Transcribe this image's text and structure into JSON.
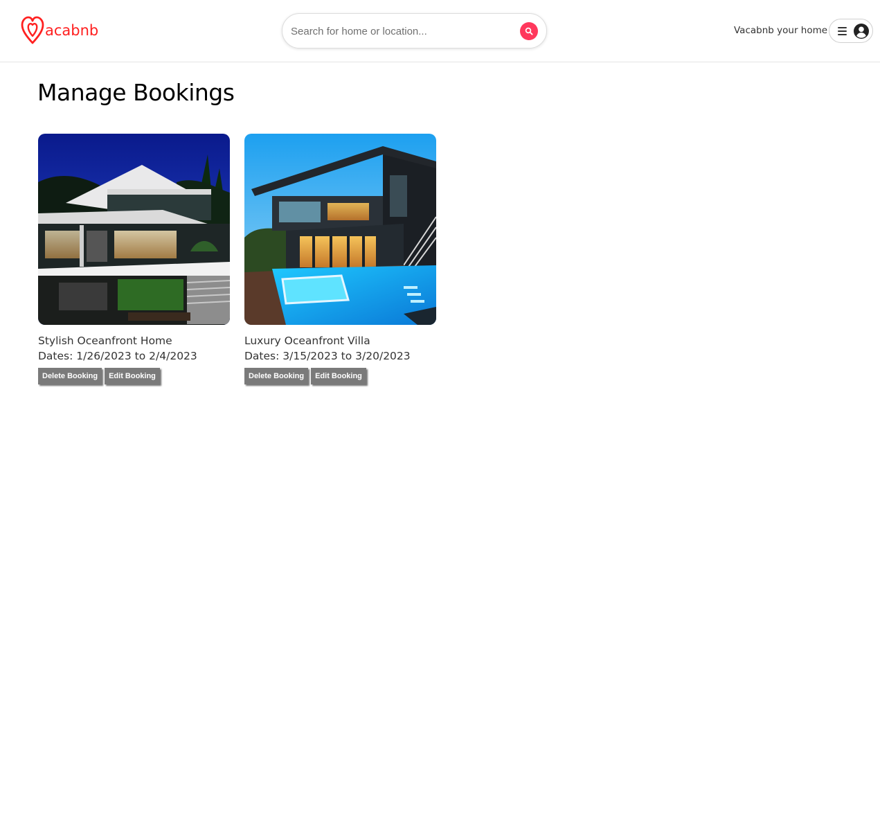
{
  "header": {
    "logo_text": "acabnb",
    "brand_color": "#ff2020",
    "search": {
      "placeholder": "Search for home or location...",
      "value": ""
    },
    "host_link": "Vacabnb your home",
    "icons": {
      "search": "search-icon",
      "menu": "hamburger-menu-icon",
      "avatar": "user-avatar-icon"
    }
  },
  "main": {
    "title": "Manage Bookings",
    "bookings": [
      {
        "name": "Stylish Oceanfront Home",
        "dates": "Dates: 1/26/2023 to 2/4/2023",
        "delete_label": "Delete Booking",
        "edit_label": "Edit Booking"
      },
      {
        "name": "Luxury Oceanfront Villa",
        "dates": "Dates: 3/15/2023 to 3/20/2023",
        "delete_label": "Delete Booking",
        "edit_label": "Edit Booking"
      }
    ]
  },
  "colors": {
    "accent": "#ff385c",
    "button_bg": "#7a7a7a",
    "divider": "#e4e4e4"
  }
}
